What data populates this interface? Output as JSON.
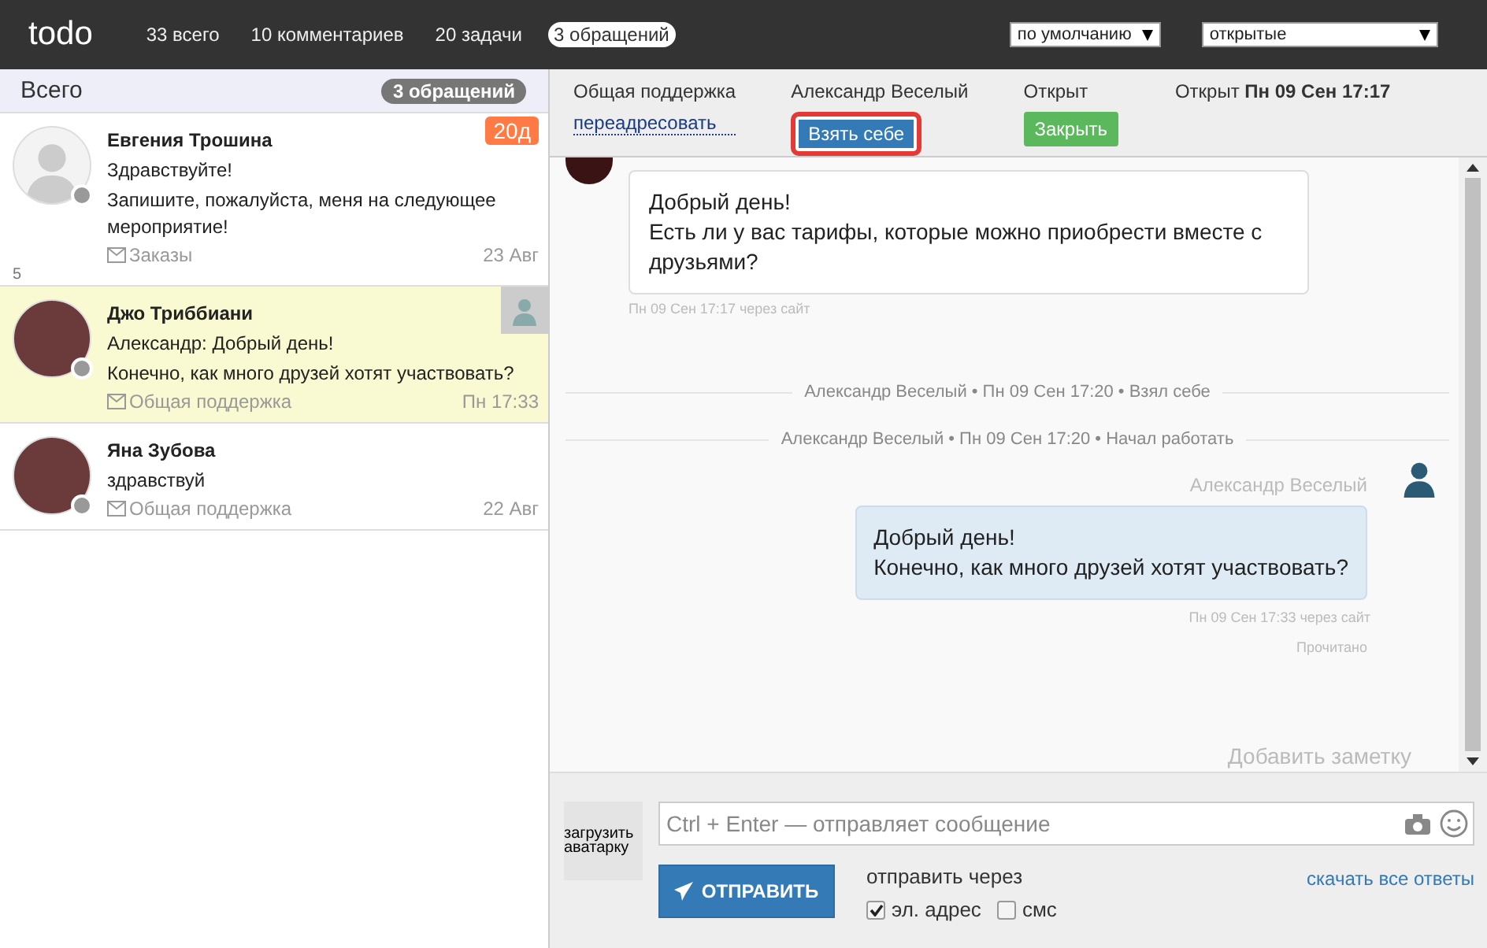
{
  "topbar": {
    "logo": "todo",
    "counters": [
      {
        "label": "33 всего",
        "selected": false
      },
      {
        "label": "10 комментариев",
        "selected": false
      },
      {
        "label": "20 задачи",
        "selected": false
      },
      {
        "label": "3 обращений",
        "selected": true
      }
    ],
    "selects": [
      {
        "value": "по умолчанию"
      },
      {
        "value": "открытые"
      }
    ]
  },
  "list_header": {
    "title": "Всего",
    "badge": "3 обращений"
  },
  "conversations": [
    {
      "name": "Евгения Трошина",
      "lines": [
        "Здравствуйте!",
        "Запишите, пожалуйста, меня на следующее мероприятие!"
      ],
      "channel": "Заказы",
      "date": "23 Авг",
      "badge": "20д",
      "count": "5",
      "kind": "silhouette",
      "assigned": false,
      "selected": false
    },
    {
      "name": "Джо Триббиани",
      "lines": [
        "Александр: Добрый день!",
        "Конечно, как много друзей хотят участвовать?"
      ],
      "channel": "Общая поддержка",
      "date": "Пн 17:33",
      "kind": "photo",
      "assigned": true,
      "selected": true
    },
    {
      "name": "Яна Зубова",
      "lines": [
        "здравствуй"
      ],
      "channel": "Общая поддержка",
      "date": "22 Авг",
      "kind": "photo",
      "assigned": false,
      "selected": false
    }
  ],
  "ticket": {
    "group": "Общая поддержка",
    "forward_link": "переадресовать",
    "assignee": "Александр Веселый",
    "take_button": {
      "label": "Взять себе",
      "highlighted": true
    },
    "status": "Открыт",
    "close_button": "Закрыть",
    "opened": "Открыт **Пн 09 Сен 17:17**"
  },
  "messages": [
    {
      "kind": "incoming",
      "lines": [
        "Добрый день!",
        "Есть ли у вас тарифы, которые можно приобрести вместе с друзьями?"
      ],
      "meta": "Пн 09 Сен 17:17 через сайт"
    },
    {
      "kind": "event",
      "text": "Александр Веселый • Пн 09 Сен 17:20 • Взял себе"
    },
    {
      "kind": "event",
      "text": "Александр Веселый • Пн 09 Сен 17:20 • Начал работать"
    },
    {
      "kind": "outgoing",
      "author": "Александр Веселый",
      "lines": [
        "Добрый день!",
        "Конечно, как много друзей хотят участвовать?"
      ],
      "meta": "Пн 09 Сен 17:33 через сайт",
      "read": "Прочитано"
    }
  ],
  "note_link": "Добавить заметку",
  "composer": {
    "avatar_upload": "загрузить аватарку",
    "placeholder": "Ctrl + Enter — отправляет сообщение",
    "send_button": "ОТПРАВИТЬ",
    "via_label": "отправить через",
    "options": [
      {
        "label": "эл. адрес",
        "checked": true
      },
      {
        "label": "смс",
        "checked": false
      }
    ],
    "download_link": "скачать все ответы"
  }
}
